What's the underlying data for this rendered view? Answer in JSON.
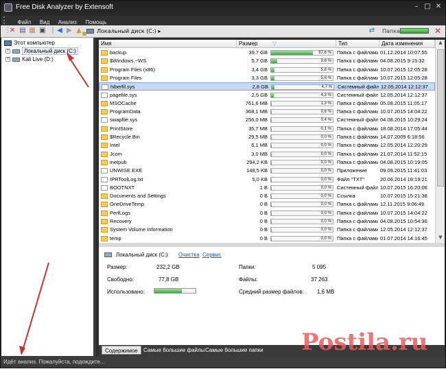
{
  "window": {
    "title": "Free Disk Analyzer by Extensoft"
  },
  "menu": [
    "Файл",
    "Вид",
    "Анализ",
    "Помощь"
  ],
  "address": {
    "path": "Локальный диск (C:)",
    "separator": "▸",
    "folder_label": "Папка:"
  },
  "tree": {
    "root": "Этот компьютер",
    "drives": [
      {
        "label": "Локальный диск (C:)",
        "selected": true
      },
      {
        "label": "Kali Live (D:)",
        "selected": false
      }
    ]
  },
  "columns": [
    "Имя",
    "Размер",
    "Тип",
    "Дата изменения"
  ],
  "rows": [
    {
      "name": "backup",
      "size": "39,7 GB",
      "pct": 67.6,
      "pct_label": "67,6 %",
      "type": "Папка с файлами",
      "date": "01.12.2014 10:07:55",
      "kind": "folder"
    },
    {
      "name": "$Windows.~WS",
      "size": "5,7 GB",
      "pct": 9.6,
      "pct_label": "9,6 %",
      "type": "Папка с файлами",
      "date": "04.08.2015 9:15:32",
      "kind": "folder"
    },
    {
      "name": "Program Files (x86)",
      "size": "3,4 GB",
      "pct": 5.8,
      "pct_label": "5,8 %",
      "type": "Папка с файлами",
      "date": "10.07.2015 12:05:28",
      "kind": "folder"
    },
    {
      "name": "Program Files",
      "size": "3,3 GB",
      "pct": 5.6,
      "pct_label": "5,6 %",
      "type": "Папка с файлами",
      "date": "10.07.2015 12:05:28",
      "kind": "folder"
    },
    {
      "name": "hiberfil.sys",
      "size": "2,8 GB",
      "pct": 4.7,
      "pct_label": "4,7 %",
      "type": "Системный файл",
      "date": "12.05.2014 12:12:37",
      "kind": "file",
      "selected": true
    },
    {
      "name": "pagefile.sys",
      "size": "2,5 GB",
      "pct": 4.3,
      "pct_label": "4,3 %",
      "type": "Системный файл",
      "date": "12.05.2014 12:12:37",
      "kind": "file"
    },
    {
      "name": "MSOCache",
      "size": "761,6 MB",
      "pct": 1.3,
      "pct_label": "1,3 %",
      "type": "Папка с файлами",
      "date": "05.08.2015 11:05:17",
      "kind": "folder"
    },
    {
      "name": "ProgramData",
      "size": "368,1 MB",
      "pct": 0.6,
      "pct_label": "0,6 %",
      "type": "Папка с файлами",
      "date": "10.07.2015 14:04:22",
      "kind": "folder"
    },
    {
      "name": "swapfile.sys",
      "size": "256,0 MB",
      "pct": 0.4,
      "pct_label": "0,4 %",
      "type": "Системный файл",
      "date": "04.08.2015 10:29:24",
      "kind": "file"
    },
    {
      "name": "PrintStore",
      "size": "35,7 MB",
      "pct": 0.1,
      "pct_label": "0,1 %",
      "type": "Папка с файлами",
      "date": "18.08.2014 17:05:44",
      "kind": "folder"
    },
    {
      "name": "$Recycle.Bin",
      "size": "29,5 MB",
      "pct": 0.0,
      "pct_label": "0,0 %",
      "type": "Папка с файлами",
      "date": "14.07.2009 6:18:56",
      "kind": "folder"
    },
    {
      "name": "Intel",
      "size": "6,1 MB",
      "pct": 0.0,
      "pct_label": "0,0 %",
      "type": "Папка с файлами",
      "date": "12.05.2014 12:20:29",
      "kind": "folder"
    },
    {
      "name": "Jcom",
      "size": "3,0 MB",
      "pct": 0.0,
      "pct_label": "0,0 %",
      "type": "Папка с файлами",
      "date": "21.07.2014 11:52:15",
      "kind": "folder"
    },
    {
      "name": "inetpub",
      "size": "294,2 KB",
      "pct": 0.0,
      "pct_label": "0,0 %",
      "type": "Папка с файлами",
      "date": "04.08.2015 10:19:05",
      "kind": "folder"
    },
    {
      "name": "UNWISE.EXE",
      "size": "148,5 KB",
      "pct": 0.0,
      "pct_label": "0,0 %",
      "type": "Приложение",
      "date": "09.09.2015 11:41:03",
      "kind": "file"
    },
    {
      "name": "IPRToolLog.txt",
      "size": "5,0 KB",
      "pct": 0.0,
      "pct_label": "0,0 %",
      "type": "Файл \"TXT\"",
      "date": "20.06.2014 18:19:21",
      "kind": "file"
    },
    {
      "name": "BOOTNXT",
      "size": "1 B",
      "pct": 0.0,
      "pct_label": "0,0 %",
      "type": "Системный файл",
      "date": "10.07.2015 16:20:06",
      "kind": "file"
    },
    {
      "name": "Documents and Settings",
      "size": "0 B",
      "pct": 0.0,
      "pct_label": "0,0 %",
      "type": "Ссылка",
      "date": "10.07.2015 15:21:38",
      "kind": "folder"
    },
    {
      "name": "OneDriveTemp",
      "size": "0 B",
      "pct": 0.0,
      "pct_label": "0,0 %",
      "type": "Папка с файлами",
      "date": "12.11.2015 9:06:49",
      "kind": "folder"
    },
    {
      "name": "PerfLogs",
      "size": "0 B",
      "pct": 0.0,
      "pct_label": "0,0 %",
      "type": "Папка с файлами",
      "date": "10.07.2015 14:04:22",
      "kind": "folder"
    },
    {
      "name": "Recovery",
      "size": "0 B",
      "pct": 0.0,
      "pct_label": "0,0 %",
      "type": "Папка с файлами",
      "date": "04.08.2015 10:54:36",
      "kind": "folder"
    },
    {
      "name": "System Volume Information",
      "size": "0 B",
      "pct": 0.0,
      "pct_label": "0,0 %",
      "type": "Папка с файлами",
      "date": "12.05.2014 12:12:37",
      "kind": "folder"
    },
    {
      "name": "temp",
      "size": "0 B",
      "pct": 0.0,
      "pct_label": "0,0 %",
      "type": "Папка с файлами",
      "date": "01.07.2014 14:16:45",
      "kind": "folder"
    }
  ],
  "info": {
    "drive": "Локальный диск (C:)",
    "cleanup_link": "Очистка",
    "service_link": "Сервис",
    "size_label": "Размер:",
    "size_value": "232,2 GB",
    "free_label": "Свободно:",
    "free_value": "77,8 GB",
    "used_label": "Использовано:",
    "used_fraction": 0.665,
    "folders_label": "Папки:",
    "folders_value": "5 095",
    "files_label": "Файлы:",
    "files_value": "37 263",
    "avg_label": "Средний размер файлов:",
    "avg_value": "1,6 MB"
  },
  "tabs": [
    "Содержимое",
    "Самые большие файлы",
    "Самые большие папки"
  ],
  "status": "Идёт анализ. Пожалуйста, подождите...",
  "watermark": "Postila.ru",
  "colors": {
    "progress": "#3ea63e",
    "selection": "#c9d9f1",
    "link": "#1d55c4",
    "annotation": "#c8322f"
  }
}
